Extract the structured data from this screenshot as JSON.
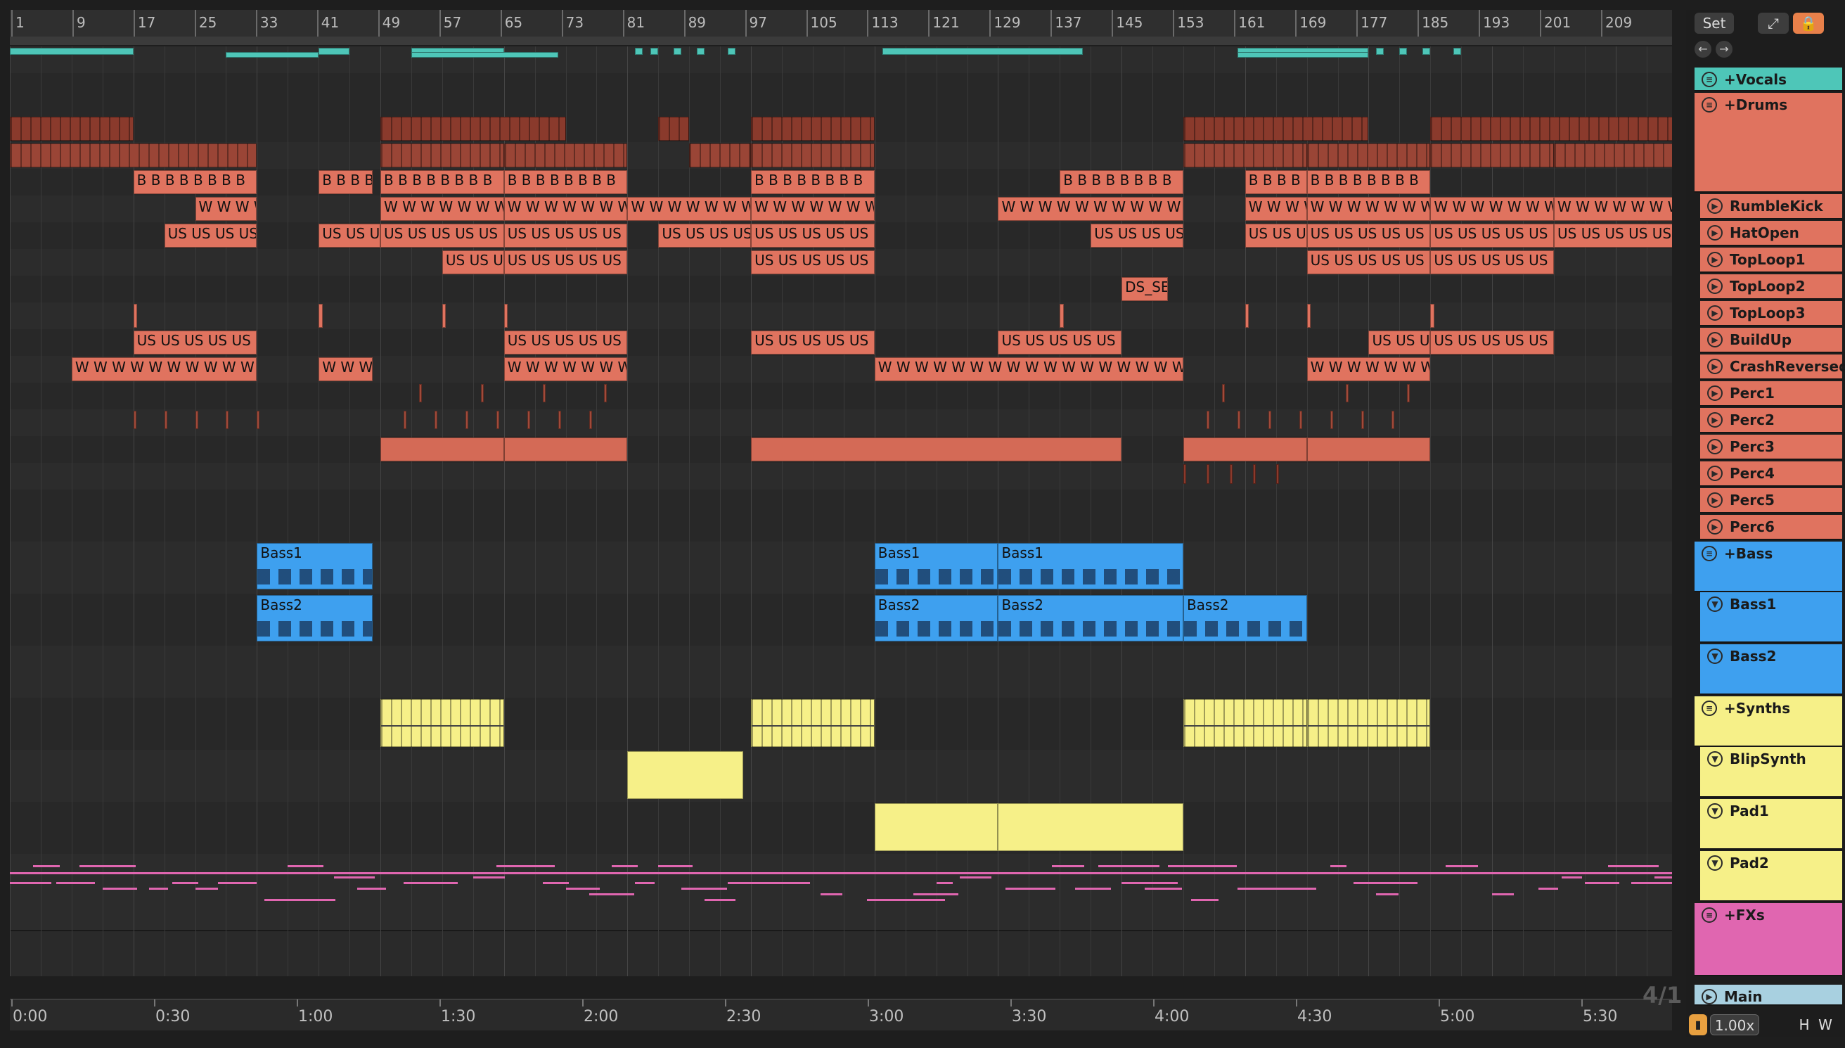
{
  "ruler": {
    "bar_numbers": [
      "1",
      "9",
      "17",
      "25",
      "33",
      "41",
      "49",
      "57",
      "65",
      "73",
      "81",
      "89",
      "97",
      "105",
      "113",
      "121",
      "129",
      "137",
      "145",
      "153",
      "161",
      "169",
      "177",
      "185",
      "193",
      "201",
      "209"
    ]
  },
  "time_axis": {
    "labels": [
      "0:00",
      "0:30",
      "1:00",
      "1:30",
      "2:00",
      "2:30",
      "3:00",
      "3:30",
      "4:00",
      "4:30",
      "5:00",
      "5:30"
    ]
  },
  "time_signature": "4/1",
  "controls": {
    "set_label": "Set",
    "expand_icon": "expand-icon",
    "lock_icon": "lock-icon",
    "back_icon": "arrow-left-icon",
    "forward_icon": "arrow-right-icon",
    "zoom_value": "1.00x",
    "h_label": "H",
    "w_label": "W"
  },
  "colors": {
    "vocals": "#4ec6b8",
    "drums": "#e0735f",
    "bass": "#3ea0ef",
    "synths": "#f6f088",
    "fx": "#e066b0",
    "main": "#a8d0e0"
  },
  "tracks": [
    {
      "name": "+Vocals",
      "type": "group"
    },
    {
      "name": "+Drums",
      "type": "group"
    },
    {
      "name": "RumbleKick",
      "type": "audio"
    },
    {
      "name": "HatOpen",
      "type": "audio"
    },
    {
      "name": "TopLoop1",
      "type": "audio"
    },
    {
      "name": "TopLoop2",
      "type": "audio"
    },
    {
      "name": "TopLoop3",
      "type": "audio"
    },
    {
      "name": "BuildUp",
      "type": "audio"
    },
    {
      "name": "CrashReversed",
      "type": "audio"
    },
    {
      "name": "Perc1",
      "type": "audio"
    },
    {
      "name": "Perc2",
      "type": "audio"
    },
    {
      "name": "Perc3",
      "type": "audio"
    },
    {
      "name": "Perc4",
      "type": "audio"
    },
    {
      "name": "Perc5",
      "type": "audio"
    },
    {
      "name": "Perc6",
      "type": "audio"
    },
    {
      "name": "+Bass",
      "type": "group"
    },
    {
      "name": "Bass1",
      "type": "midi"
    },
    {
      "name": "Bass2",
      "type": "midi"
    },
    {
      "name": "+Synths",
      "type": "group"
    },
    {
      "name": "BlipSynth",
      "type": "midi"
    },
    {
      "name": "Pad1",
      "type": "midi"
    },
    {
      "name": "Pad2",
      "type": "midi"
    },
    {
      "name": "+FXs",
      "type": "group"
    },
    {
      "name": "Main",
      "type": "main"
    }
  ],
  "clip_labels": {
    "hat": "B",
    "toploop1": "W",
    "toploop2": "US",
    "buildup": "DS_SE",
    "bass1": "Bass1",
    "bass2": "Bass2"
  }
}
